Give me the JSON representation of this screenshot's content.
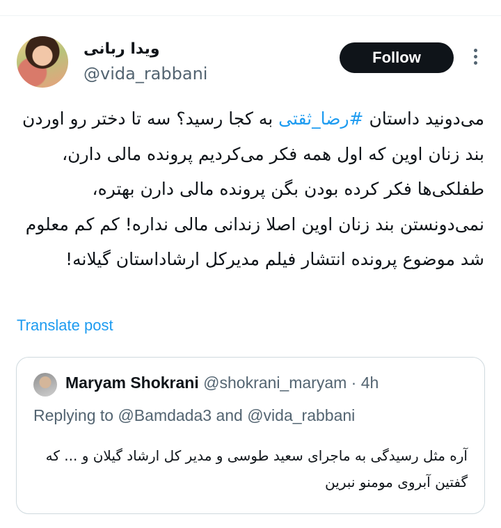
{
  "author": {
    "display_name": "ویدا ربانی",
    "handle": "@vida_rabbani"
  },
  "actions": {
    "follow_label": "Follow",
    "more_icon": "more-horizontal-icon"
  },
  "tweet": {
    "text_before": "می‌دونید داستان ",
    "hashtag": "#رضا_ثقتی",
    "text_after": " به کجا رسید؟ سه تا دختر رو اوردن بند زنان اوین که اول همه فکر می‌کردیم پرونده مالی دارن، طفلکی‌ها فکر کرده بودن بگن پرونده مالی دارن بهتره، نمی‌دونستن بند زنان اوین اصلا زندانی مالی نداره! کم کم معلوم شد موضوع پرونده انتشار فیلم مدیرکل ارشاداستان گیلانه!",
    "translate_label": "Translate post"
  },
  "quote": {
    "name": "Maryam Shokrani",
    "handle": "@shokrani_maryam",
    "separator": "·",
    "time": "4h",
    "replying_to": "Replying to @Bamdada3 and @vida_rabbani",
    "text": "آره مثل رسیدگی به ماجرای سعید طوسی و مدیر کل ارشاد گیلان و ... که گفتین آبروی مومنو نبرین"
  }
}
